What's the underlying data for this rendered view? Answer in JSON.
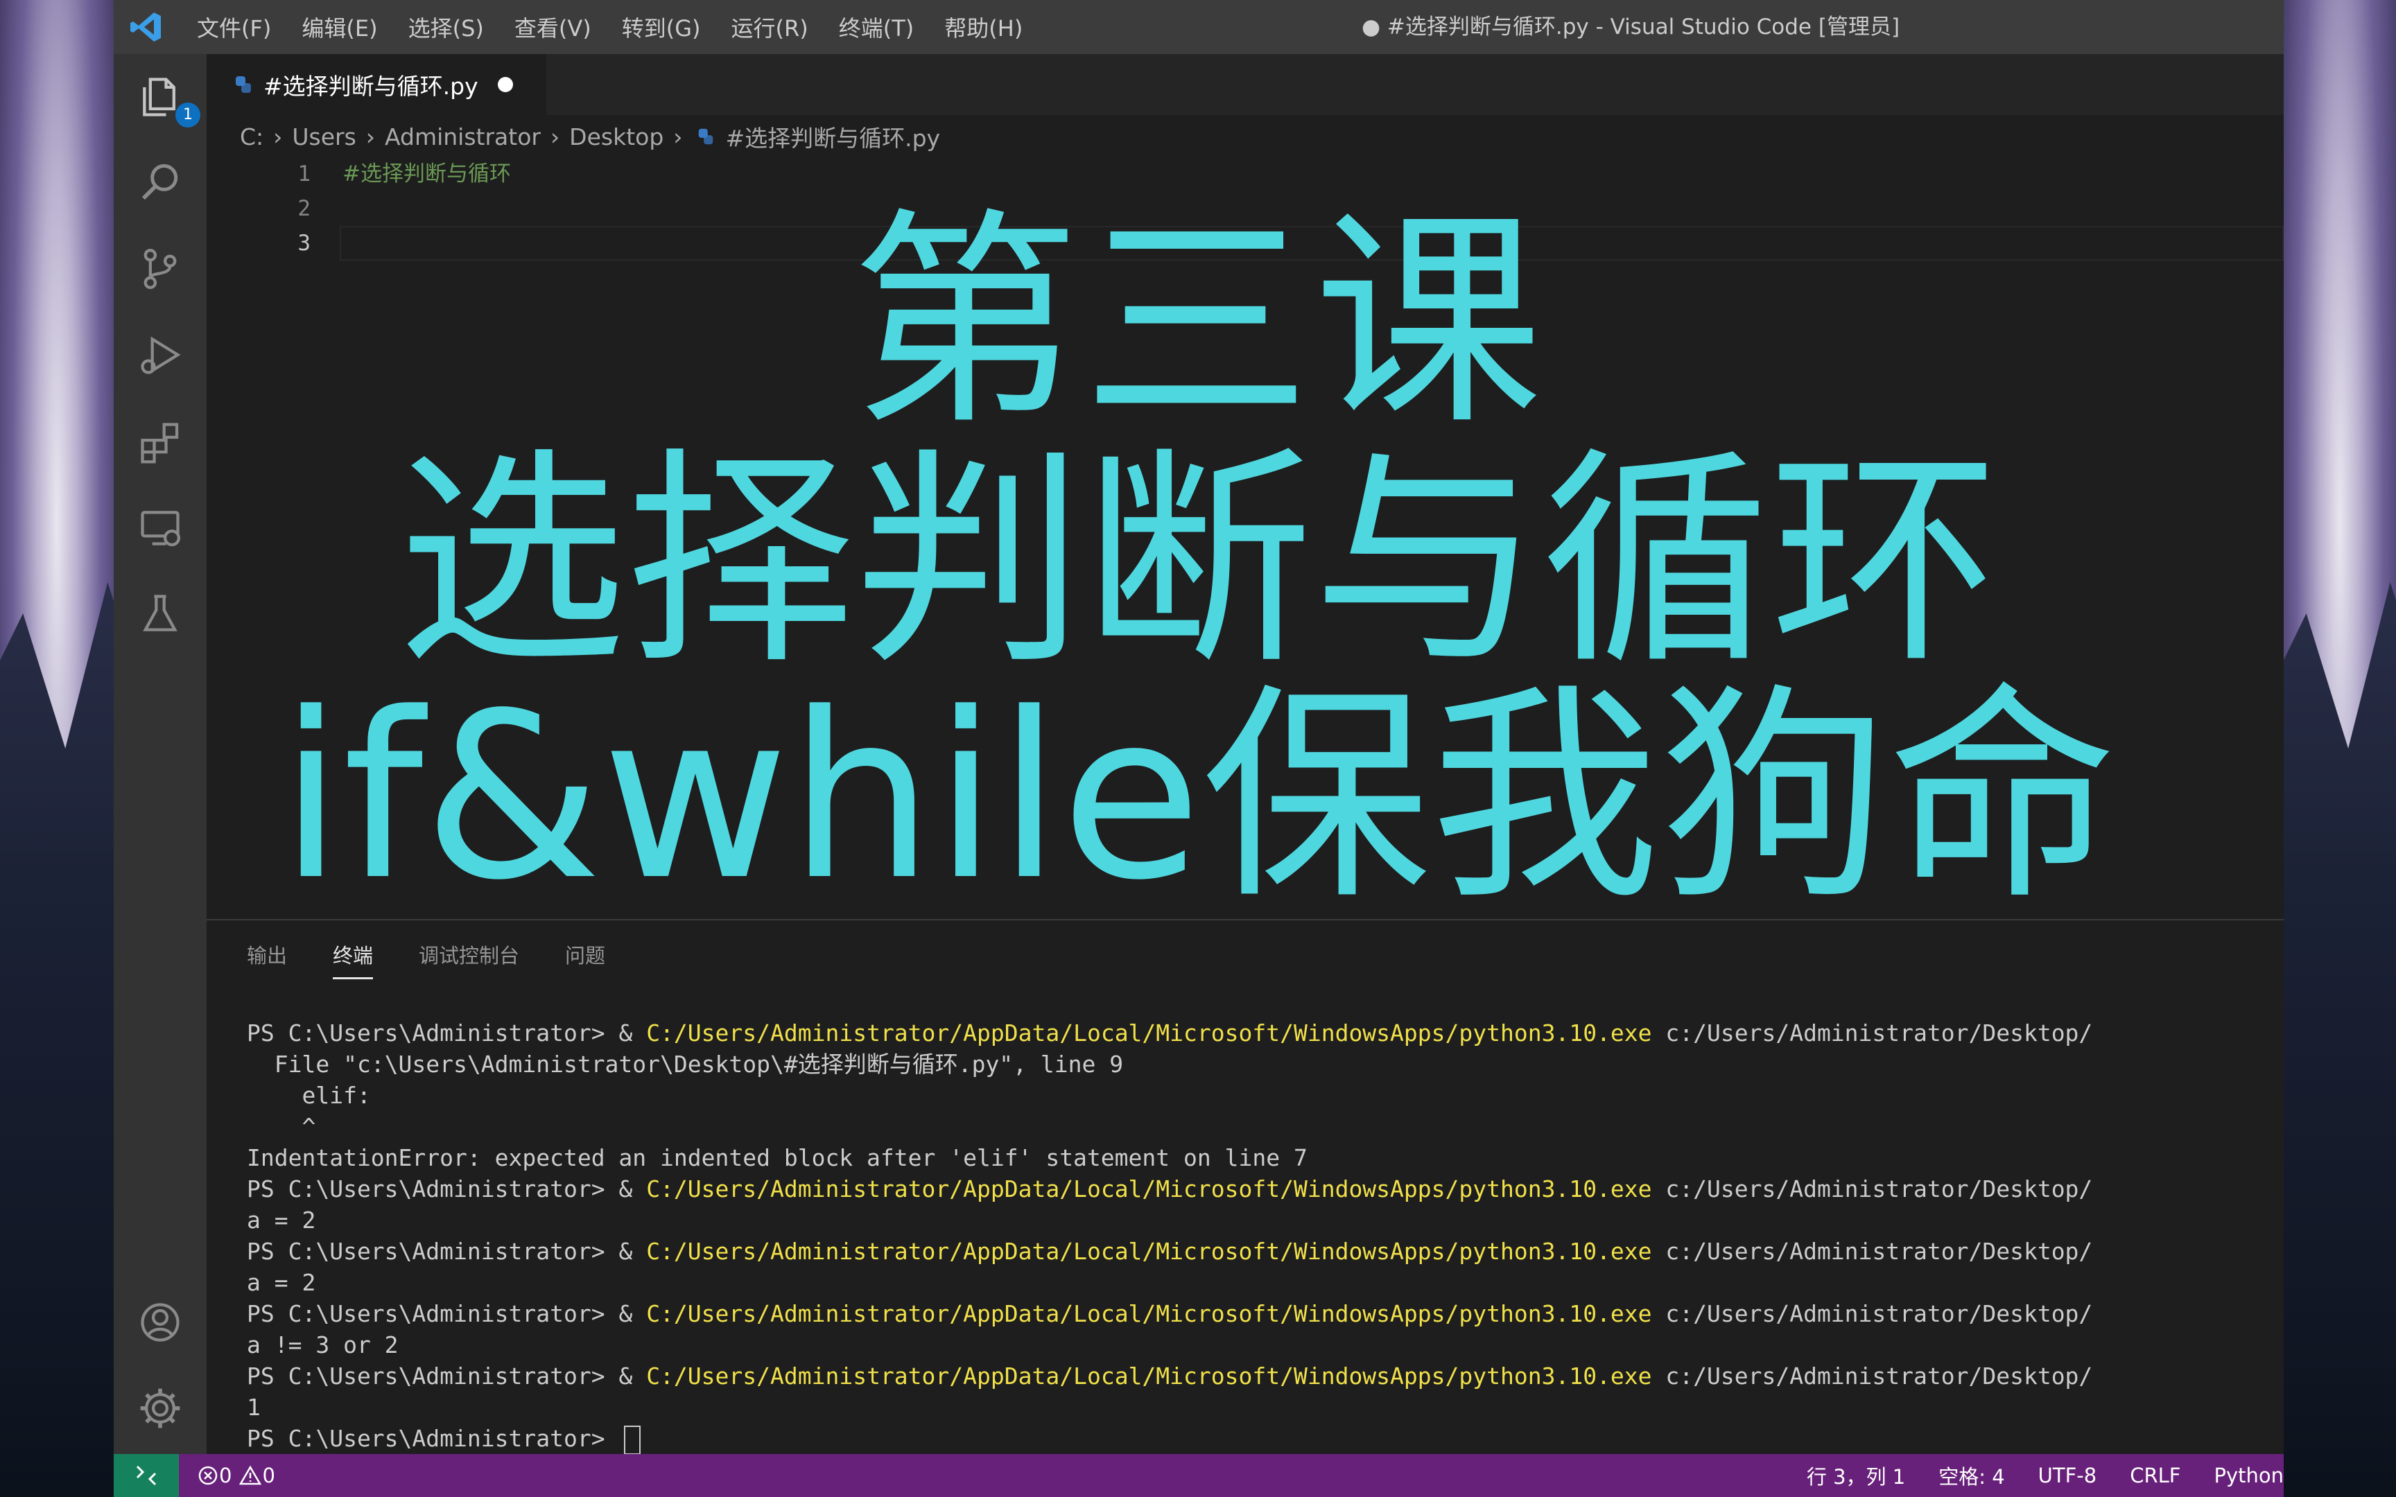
{
  "menu": [
    "文件(F)",
    "编辑(E)",
    "选择(S)",
    "查看(V)",
    "转到(G)",
    "运行(R)",
    "终端(T)",
    "帮助(H)"
  ],
  "window_title": "● #选择判断与循环.py - Visual Studio Code [管理员]",
  "activity": {
    "explorer_badge": "1"
  },
  "tab": {
    "name": "#选择判断与循环.py"
  },
  "breadcrumb": [
    "C:",
    "Users",
    "Administrator",
    "Desktop",
    "#选择判断与循环.py"
  ],
  "editor": {
    "lines": [
      {
        "n": "1",
        "text": "#选择判断与循环"
      },
      {
        "n": "2",
        "text": ""
      },
      {
        "n": "3",
        "text": ""
      }
    ]
  },
  "overlay": {
    "line1": "第三课",
    "line2": "选择判断与循环",
    "line3": "if&while保我狗命",
    "color": "#4fd7df"
  },
  "panel": {
    "tabs": [
      "输出",
      "终端",
      "调试控制台",
      "问题"
    ],
    "active_tab": "终端"
  },
  "terminal": {
    "prompt": "PS C:\\Users\\Administrator> ",
    "exe": "C:/Users/Administrator/AppData/Local/Microsoft/WindowsApps/python3.10.exe",
    "arg": " c:/Users/Administrator/Desktop/",
    "lines": [
      "  File \"c:\\Users\\Administrator\\Desktop\\#选择判断与循环.py\", line 9",
      "    elif:",
      "    ^",
      "IndentationError: expected an indented block after 'elif' statement on line 7",
      "a = 2",
      "a = 2",
      "a != 3 or 2",
      "1"
    ]
  },
  "status": {
    "errors": "0",
    "warnings": "0",
    "position": "行 3，列 1",
    "spaces": "空格: 4",
    "encoding": "UTF-8",
    "eol": "CRLF",
    "language": "Python"
  }
}
